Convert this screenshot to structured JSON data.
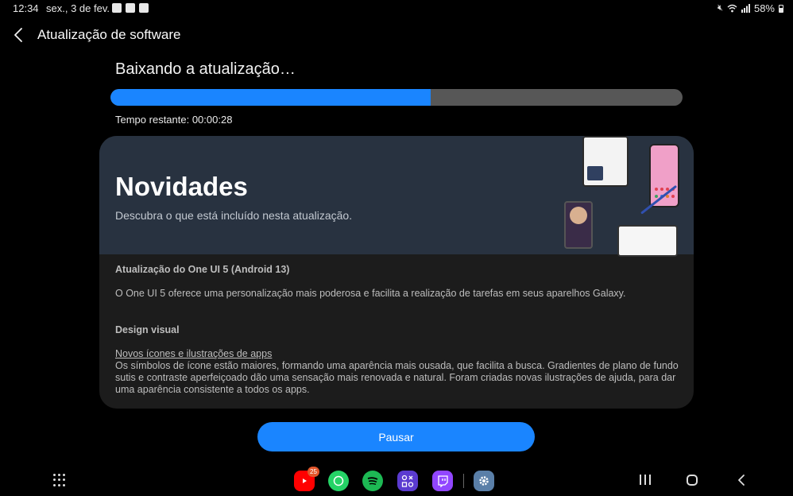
{
  "status_bar": {
    "time": "12:34",
    "date": "sex., 3 de fev.",
    "battery": "58%",
    "battery_level": 0.58,
    "notification_icons": [
      "youtube-notification-icon",
      "tiktok-notification-icon",
      "gallery-notification-icon"
    ],
    "system_icons": [
      "mute-icon",
      "wifi-icon",
      "signal-icon",
      "battery-icon"
    ]
  },
  "header": {
    "title": "Atualização de software",
    "back_icon": "chevron-left-icon"
  },
  "download": {
    "title": "Baixando a atualização…",
    "progress_fraction": 0.56,
    "time_remaining": "Tempo restante: 00:00:28"
  },
  "card": {
    "banner_title": "Novidades",
    "banner_subtitle": "Descubra o que está incluído nesta atualização.",
    "update_heading": "Atualização do One UI 5 (Android 13)",
    "update_description": "O One UI 5 oferece uma personalização mais poderosa e facilita a realização de tarefas em seus aparelhos Galaxy.",
    "section_heading": "Design visual",
    "subsection_link": "Novos ícones e ilustrações de apps",
    "subsection_text": "Os símbolos de ícone estão maiores, formando uma aparência mais ousada, que facilita a busca. Gradientes de plano de fundo sutis e contraste aperfeiçoado dão uma sensação mais renovada e natural. Foram criadas novas ilustrações de ajuda, para dar uma aparência consistente a todos os apps."
  },
  "actions": {
    "pause_label": "Pausar"
  },
  "navbar": {
    "dock_apps": [
      {
        "name": "youtube-app-icon",
        "color": "#ff0000",
        "badge": "25"
      },
      {
        "name": "whatsapp-app-icon",
        "color": "#25d366",
        "badge": ""
      },
      {
        "name": "spotify-app-icon",
        "color": "#1db954",
        "badge": ""
      },
      {
        "name": "game-launcher-app-icon",
        "color": "#5b3bd0",
        "badge": ""
      },
      {
        "name": "twitch-app-icon",
        "color": "#9146ff",
        "badge": ""
      },
      {
        "name": "settings-app-icon",
        "color": "#5a7fa8",
        "badge": ""
      }
    ]
  },
  "colors": {
    "accent": "#1a85ff",
    "banner": "#283240",
    "card": "#1c1c1c",
    "progress_track": "#575757"
  }
}
